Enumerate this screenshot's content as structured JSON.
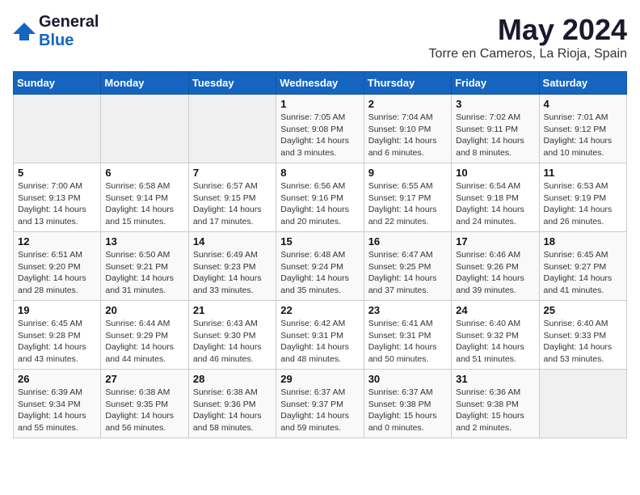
{
  "header": {
    "logo_general": "General",
    "logo_blue": "Blue",
    "month_year": "May 2024",
    "location": "Torre en Cameros, La Rioja, Spain"
  },
  "weekdays": [
    "Sunday",
    "Monday",
    "Tuesday",
    "Wednesday",
    "Thursday",
    "Friday",
    "Saturday"
  ],
  "weeks": [
    [
      {
        "day": "",
        "sunrise": "",
        "sunset": "",
        "daylight": ""
      },
      {
        "day": "",
        "sunrise": "",
        "sunset": "",
        "daylight": ""
      },
      {
        "day": "",
        "sunrise": "",
        "sunset": "",
        "daylight": ""
      },
      {
        "day": "1",
        "sunrise": "Sunrise: 7:05 AM",
        "sunset": "Sunset: 9:08 PM",
        "daylight": "Daylight: 14 hours and 3 minutes."
      },
      {
        "day": "2",
        "sunrise": "Sunrise: 7:04 AM",
        "sunset": "Sunset: 9:10 PM",
        "daylight": "Daylight: 14 hours and 6 minutes."
      },
      {
        "day": "3",
        "sunrise": "Sunrise: 7:02 AM",
        "sunset": "Sunset: 9:11 PM",
        "daylight": "Daylight: 14 hours and 8 minutes."
      },
      {
        "day": "4",
        "sunrise": "Sunrise: 7:01 AM",
        "sunset": "Sunset: 9:12 PM",
        "daylight": "Daylight: 14 hours and 10 minutes."
      }
    ],
    [
      {
        "day": "5",
        "sunrise": "Sunrise: 7:00 AM",
        "sunset": "Sunset: 9:13 PM",
        "daylight": "Daylight: 14 hours and 13 minutes."
      },
      {
        "day": "6",
        "sunrise": "Sunrise: 6:58 AM",
        "sunset": "Sunset: 9:14 PM",
        "daylight": "Daylight: 14 hours and 15 minutes."
      },
      {
        "day": "7",
        "sunrise": "Sunrise: 6:57 AM",
        "sunset": "Sunset: 9:15 PM",
        "daylight": "Daylight: 14 hours and 17 minutes."
      },
      {
        "day": "8",
        "sunrise": "Sunrise: 6:56 AM",
        "sunset": "Sunset: 9:16 PM",
        "daylight": "Daylight: 14 hours and 20 minutes."
      },
      {
        "day": "9",
        "sunrise": "Sunrise: 6:55 AM",
        "sunset": "Sunset: 9:17 PM",
        "daylight": "Daylight: 14 hours and 22 minutes."
      },
      {
        "day": "10",
        "sunrise": "Sunrise: 6:54 AM",
        "sunset": "Sunset: 9:18 PM",
        "daylight": "Daylight: 14 hours and 24 minutes."
      },
      {
        "day": "11",
        "sunrise": "Sunrise: 6:53 AM",
        "sunset": "Sunset: 9:19 PM",
        "daylight": "Daylight: 14 hours and 26 minutes."
      }
    ],
    [
      {
        "day": "12",
        "sunrise": "Sunrise: 6:51 AM",
        "sunset": "Sunset: 9:20 PM",
        "daylight": "Daylight: 14 hours and 28 minutes."
      },
      {
        "day": "13",
        "sunrise": "Sunrise: 6:50 AM",
        "sunset": "Sunset: 9:21 PM",
        "daylight": "Daylight: 14 hours and 31 minutes."
      },
      {
        "day": "14",
        "sunrise": "Sunrise: 6:49 AM",
        "sunset": "Sunset: 9:23 PM",
        "daylight": "Daylight: 14 hours and 33 minutes."
      },
      {
        "day": "15",
        "sunrise": "Sunrise: 6:48 AM",
        "sunset": "Sunset: 9:24 PM",
        "daylight": "Daylight: 14 hours and 35 minutes."
      },
      {
        "day": "16",
        "sunrise": "Sunrise: 6:47 AM",
        "sunset": "Sunset: 9:25 PM",
        "daylight": "Daylight: 14 hours and 37 minutes."
      },
      {
        "day": "17",
        "sunrise": "Sunrise: 6:46 AM",
        "sunset": "Sunset: 9:26 PM",
        "daylight": "Daylight: 14 hours and 39 minutes."
      },
      {
        "day": "18",
        "sunrise": "Sunrise: 6:45 AM",
        "sunset": "Sunset: 9:27 PM",
        "daylight": "Daylight: 14 hours and 41 minutes."
      }
    ],
    [
      {
        "day": "19",
        "sunrise": "Sunrise: 6:45 AM",
        "sunset": "Sunset: 9:28 PM",
        "daylight": "Daylight: 14 hours and 43 minutes."
      },
      {
        "day": "20",
        "sunrise": "Sunrise: 6:44 AM",
        "sunset": "Sunset: 9:29 PM",
        "daylight": "Daylight: 14 hours and 44 minutes."
      },
      {
        "day": "21",
        "sunrise": "Sunrise: 6:43 AM",
        "sunset": "Sunset: 9:30 PM",
        "daylight": "Daylight: 14 hours and 46 minutes."
      },
      {
        "day": "22",
        "sunrise": "Sunrise: 6:42 AM",
        "sunset": "Sunset: 9:31 PM",
        "daylight": "Daylight: 14 hours and 48 minutes."
      },
      {
        "day": "23",
        "sunrise": "Sunrise: 6:41 AM",
        "sunset": "Sunset: 9:31 PM",
        "daylight": "Daylight: 14 hours and 50 minutes."
      },
      {
        "day": "24",
        "sunrise": "Sunrise: 6:40 AM",
        "sunset": "Sunset: 9:32 PM",
        "daylight": "Daylight: 14 hours and 51 minutes."
      },
      {
        "day": "25",
        "sunrise": "Sunrise: 6:40 AM",
        "sunset": "Sunset: 9:33 PM",
        "daylight": "Daylight: 14 hours and 53 minutes."
      }
    ],
    [
      {
        "day": "26",
        "sunrise": "Sunrise: 6:39 AM",
        "sunset": "Sunset: 9:34 PM",
        "daylight": "Daylight: 14 hours and 55 minutes."
      },
      {
        "day": "27",
        "sunrise": "Sunrise: 6:38 AM",
        "sunset": "Sunset: 9:35 PM",
        "daylight": "Daylight: 14 hours and 56 minutes."
      },
      {
        "day": "28",
        "sunrise": "Sunrise: 6:38 AM",
        "sunset": "Sunset: 9:36 PM",
        "daylight": "Daylight: 14 hours and 58 minutes."
      },
      {
        "day": "29",
        "sunrise": "Sunrise: 6:37 AM",
        "sunset": "Sunset: 9:37 PM",
        "daylight": "Daylight: 14 hours and 59 minutes."
      },
      {
        "day": "30",
        "sunrise": "Sunrise: 6:37 AM",
        "sunset": "Sunset: 9:38 PM",
        "daylight": "Daylight: 15 hours and 0 minutes."
      },
      {
        "day": "31",
        "sunrise": "Sunrise: 6:36 AM",
        "sunset": "Sunset: 9:38 PM",
        "daylight": "Daylight: 15 hours and 2 minutes."
      },
      {
        "day": "",
        "sunrise": "",
        "sunset": "",
        "daylight": ""
      }
    ]
  ]
}
